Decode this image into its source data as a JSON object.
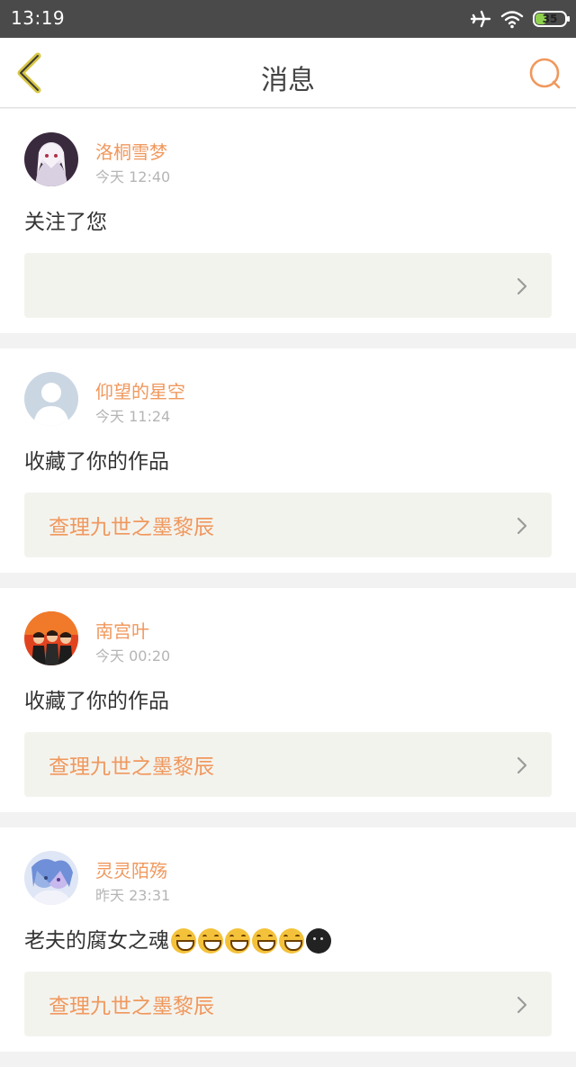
{
  "status_bar": {
    "time": "13:19",
    "battery": "35"
  },
  "nav": {
    "title": "消息"
  },
  "colors": {
    "accent": "#f0985d",
    "link_bg": "#f3f3ee"
  },
  "messages": [
    {
      "user": "洛桐雪梦",
      "time": "今天 12:40",
      "action": "关注了您",
      "link_text": ""
    },
    {
      "user": "仰望的星空",
      "time": "今天 11:24",
      "action": "收藏了你的作品",
      "link_text": "查理九世之墨黎辰"
    },
    {
      "user": "南宫叶",
      "time": "今天 00:20",
      "action": "收藏了你的作品",
      "link_text": "查理九世之墨黎辰"
    },
    {
      "user": "灵灵陌殇",
      "time": "昨天 23:31",
      "action": "老夫的腐女之魂",
      "link_text": "查理九世之墨黎辰"
    }
  ]
}
